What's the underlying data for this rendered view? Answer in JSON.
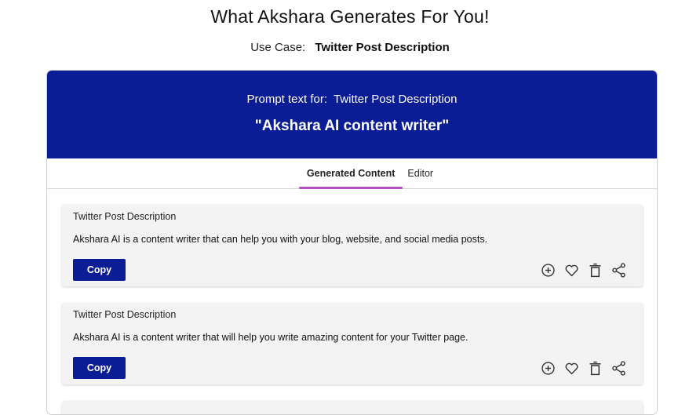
{
  "header": {
    "title": "What Akshara Generates For You!",
    "use_case_label": "Use Case:",
    "use_case_value": "Twitter Post Description"
  },
  "banner": {
    "prompt_for_label": "Prompt text for:",
    "prompt_for_value": "Twitter Post Description",
    "prompt_text": "\"Akshara AI content writer\""
  },
  "tabs": [
    {
      "label": "Generated Content",
      "active": true
    },
    {
      "label": "Editor",
      "active": false
    }
  ],
  "results": [
    {
      "title": "Twitter Post Description",
      "text": "Akshara AI is a content writer that can help you with your blog, website, and social media posts.",
      "copy_label": "Copy"
    },
    {
      "title": "Twitter Post Description",
      "text": "Akshara AI is a content writer that will help you write amazing content for your Twitter page.",
      "copy_label": "Copy"
    }
  ],
  "icons": [
    "add-circle-icon",
    "heart-icon",
    "trash-icon",
    "share-icon"
  ],
  "colors": {
    "brand": "#0b1d94",
    "tab_indicator": "#b44fc4",
    "card_bg": "#f3f3f3"
  }
}
